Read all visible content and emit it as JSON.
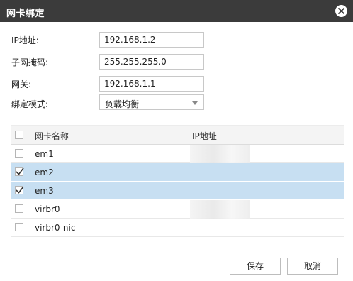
{
  "dialog": {
    "title": "网卡绑定"
  },
  "form": {
    "ip_label": "IP地址:",
    "ip_value": "192.168.1.2",
    "mask_label": "子网掩码:",
    "mask_value": "255.255.255.0",
    "gateway_label": "网关:",
    "gateway_value": "192.168.1.1",
    "mode_label": "绑定模式:",
    "mode_value": "负载均衡"
  },
  "table": {
    "col_name": "网卡名称",
    "col_ip": "IP地址",
    "rows": [
      {
        "name": "em1",
        "checked": false
      },
      {
        "name": "em2",
        "checked": true
      },
      {
        "name": "em3",
        "checked": true
      },
      {
        "name": "virbr0",
        "checked": false
      },
      {
        "name": "virbr0-nic",
        "checked": false
      }
    ]
  },
  "buttons": {
    "save": "保存",
    "cancel": "取消"
  },
  "colors": {
    "titlebar": "#3b3b3b",
    "selected_row": "#c7dff2"
  },
  "icons": {
    "close": "close-icon",
    "check": "checkmark-icon",
    "dropdown": "chevron-down-icon"
  }
}
